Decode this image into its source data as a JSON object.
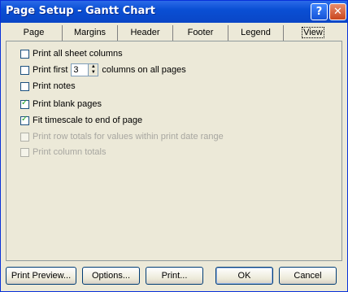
{
  "window": {
    "title": "Page Setup - Gantt Chart",
    "help_glyph": "?",
    "close_glyph": "✕"
  },
  "tabs": [
    {
      "label": "Page"
    },
    {
      "label": "Margins"
    },
    {
      "label": "Header"
    },
    {
      "label": "Footer"
    },
    {
      "label": "Legend"
    },
    {
      "label": "View"
    }
  ],
  "options": {
    "print_all_sheet_columns": {
      "label": "Print all sheet columns",
      "checked": false,
      "enabled": true
    },
    "print_first": {
      "label_before": "Print first",
      "value": "3",
      "label_after": "columns on all pages",
      "checked": false,
      "enabled": true
    },
    "print_notes": {
      "label": "Print notes",
      "checked": false,
      "enabled": true
    },
    "print_blank_pages": {
      "label": "Print blank pages",
      "checked": true,
      "enabled": true
    },
    "fit_timescale": {
      "label": "Fit timescale to end of page",
      "checked": true,
      "enabled": true
    },
    "print_row_totals": {
      "label": "Print row totals for values within print date range",
      "checked": false,
      "enabled": false
    },
    "print_column_totals": {
      "label": "Print column totals",
      "checked": false,
      "enabled": false
    }
  },
  "buttons": {
    "print_preview": "Print Preview...",
    "options": "Options...",
    "print": "Print...",
    "ok": "OK",
    "cancel": "Cancel"
  },
  "colors": {
    "titlebar": "#0a4fd4",
    "dialog_bg": "#ece9d8",
    "check": "#21a121"
  }
}
